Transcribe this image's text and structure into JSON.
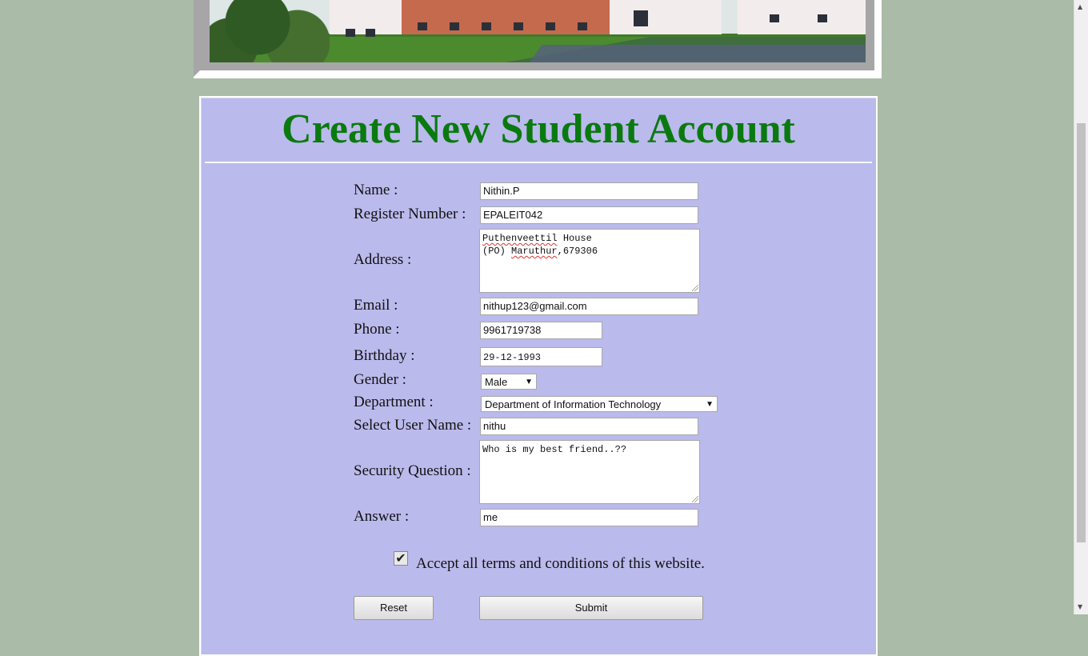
{
  "banner": {
    "image": "college-building-photo"
  },
  "form": {
    "title": "Create New Student Account",
    "fields": {
      "name": {
        "label": "Name :",
        "value": "Nithin.P"
      },
      "register_number": {
        "label": "Register Number :",
        "value": "EPALEIT042"
      },
      "address": {
        "label": "Address :",
        "line1_word1": "Puthenveettil",
        "line1_rest": " House",
        "line2_prefix": "(PO) ",
        "line2_word": "Maruthur",
        "line2_rest": ",679306"
      },
      "email": {
        "label": "Email :",
        "value": "nithup123@gmail.com"
      },
      "phone": {
        "label": "Phone :",
        "value": "9961719738"
      },
      "birthday": {
        "label": "Birthday :",
        "value": "29-12-1993"
      },
      "gender": {
        "label": "Gender :",
        "selected": "Male"
      },
      "department": {
        "label": "Department :",
        "selected": "Department of Information Technology"
      },
      "username": {
        "label": "Select User Name :",
        "value": "nithu"
      },
      "security_question": {
        "label": "Security Question :",
        "value": "Who is my best friend..??"
      },
      "answer": {
        "label": "Answer :",
        "value": "me"
      }
    },
    "terms": {
      "checked": true,
      "check_glyph": "✔",
      "label": "Accept all terms and conditions of this website."
    },
    "buttons": {
      "reset": "Reset",
      "submit": "Submit"
    },
    "dropdown_caret": "▼"
  },
  "scrollbar": {
    "up": "▲",
    "down": "▼"
  },
  "colors": {
    "title": "#0a7a10",
    "panel": "#bbbaec",
    "page_bg": "#aabba8"
  }
}
